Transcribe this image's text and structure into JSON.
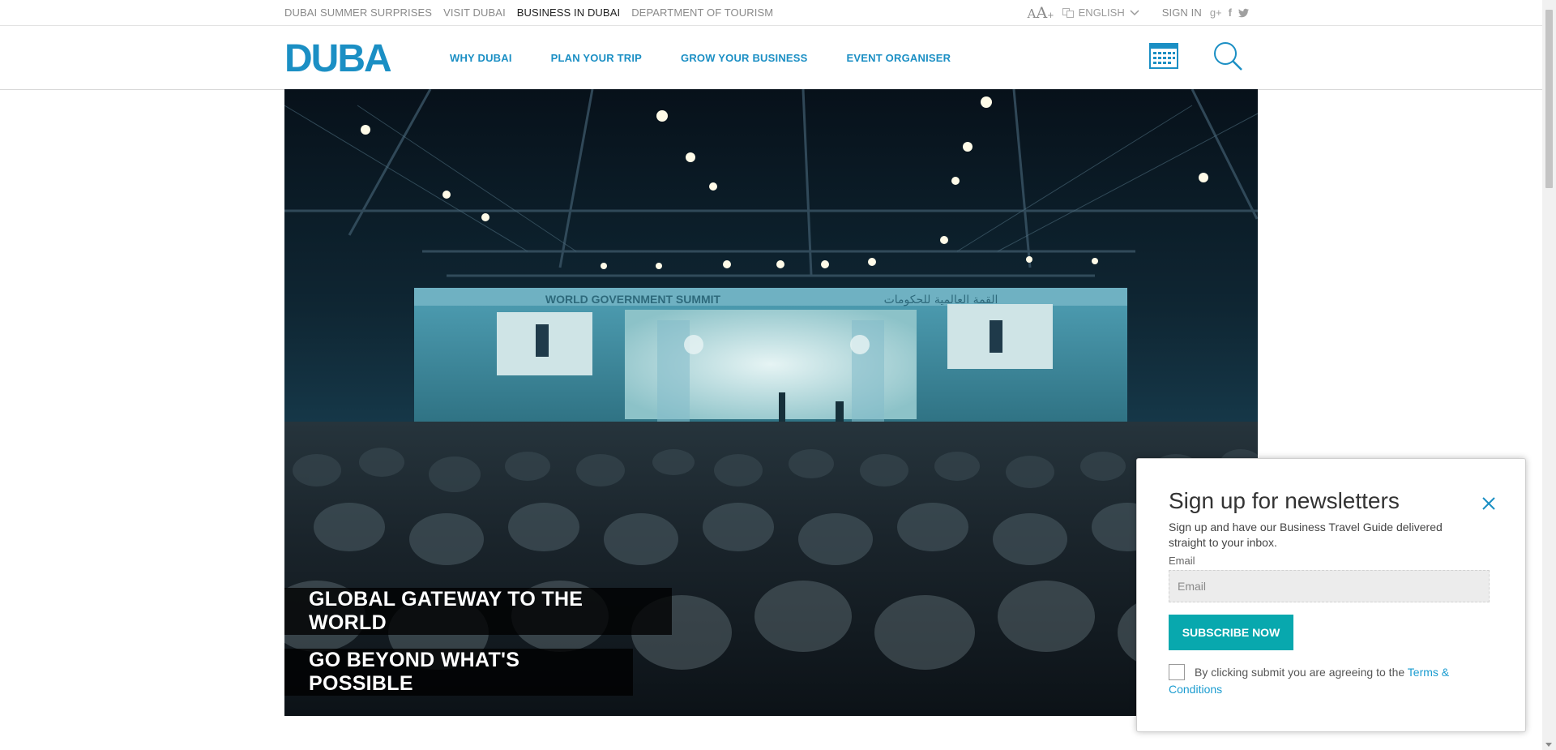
{
  "util_bar": {
    "links": [
      {
        "label": "DUBAI SUMMER SURPRISES",
        "active": false
      },
      {
        "label": "VISIT DUBAI",
        "active": false
      },
      {
        "label": "BUSINESS IN DUBAI",
        "active": true
      },
      {
        "label": "DEPARTMENT OF TOURISM",
        "active": false
      }
    ],
    "text_size_small": "A",
    "text_size_large": "A",
    "text_size_plus": "+",
    "language": "ENGLISH",
    "sign_in": "SIGN IN",
    "social_icons": [
      "google-plus-icon",
      "facebook-icon",
      "twitter-icon"
    ],
    "social_glyphs": {
      "google": "g+",
      "facebook": "f",
      "twitter": "t"
    }
  },
  "header": {
    "logo_text": "DUBAI",
    "nav": [
      {
        "label": "WHY DUBAI"
      },
      {
        "label": "PLAN YOUR TRIP"
      },
      {
        "label": "GROW YOUR BUSINESS"
      },
      {
        "label": "EVENT ORGANISER"
      }
    ]
  },
  "hero": {
    "caption_1": "GLOBAL GATEWAY TO THE WORLD",
    "caption_2": "GO BEYOND WHAT'S POSSIBLE",
    "banner_text": "WORLD GOVERNMENT SUMMIT",
    "banner_arabic": "القمة العالمية للحكومات"
  },
  "newsletter": {
    "title": "Sign up for newsletters",
    "description": "Sign up and have our Business Travel Guide delivered straight to your inbox.",
    "email_label": "Email",
    "email_placeholder": "Email",
    "email_value": "",
    "subscribe_label": "SUBSCRIBE NOW",
    "terms_text": "By clicking submit you are agreeing to the ",
    "terms_link": "Terms & Conditions"
  },
  "colors": {
    "accent": "#1b8fc4",
    "subscribe": "#08a8ae",
    "link": "#1b9cd0"
  }
}
